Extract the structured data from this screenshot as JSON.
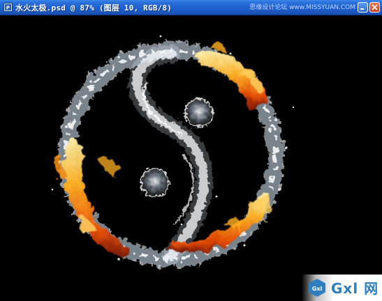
{
  "window": {
    "title": "水火太极.psd @ 87% (图层 10, RGB/8)",
    "watermark": "思缘设计论坛 www.MISSYUAN.COM",
    "icon": "photoshop-document-icon",
    "buttons": [
      "minimize-icon",
      "close-icon"
    ]
  },
  "canvas": {
    "artwork": "water-fire-taiji-symbol",
    "background": "#000000"
  },
  "logo": {
    "mark_text": "Gxl",
    "text": "Gxl 网",
    "accent": "#2f7fbf"
  },
  "colors": {
    "titlebar": "#1f5fcf",
    "close": "#c8411b",
    "fire": "#ff8a1a",
    "water": "#e8f4ff"
  }
}
